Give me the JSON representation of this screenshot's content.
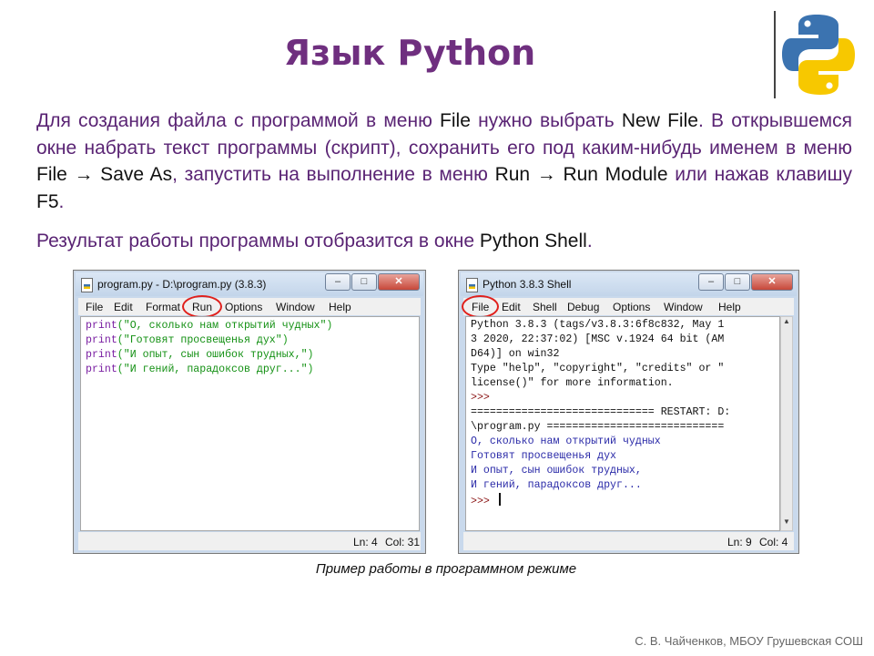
{
  "slide": {
    "title": "Язык Python",
    "para1_a": "Для создания файла с программой в меню ",
    "para1_b": "File",
    "para1_c": " нужно выбрать ",
    "para1_d": "New File",
    "para1_e": ". В открывшемся окне набрать текст программы (скрипт), сохранить его под каким-нибудь именем в меню ",
    "para1_f": "File → Save As",
    "para1_g": ", запустить на выполнение в меню ",
    "para1_h": "Run → Run Module",
    "para1_i": " или нажав клавишу ",
    "para1_j": "F5",
    "para1_k": ".",
    "para2_a": "Результат работы программы отобразится в окне ",
    "para2_b": "Python Shell",
    "para2_c": ".",
    "caption": "Пример работы в программном режиме",
    "footer": "С. В. Чайченков, МБОУ Грушевская СОШ",
    "logo_icon": "python-logo-icon",
    "accent_color": "#6f2f7f"
  },
  "editor": {
    "title": "program.py - D:\\program.py (3.8.3)",
    "menu": [
      "File",
      "Edit",
      "Format",
      "Run",
      "Options",
      "Window",
      "Help"
    ],
    "code": [
      {
        "kw": "print",
        "open": "(",
        "str": "\"О, сколько нам открытий чудных\"",
        "close": ")"
      },
      {
        "kw": "print",
        "open": "(",
        "str": "\"Готовят просвещенья дух\"",
        "close": ")"
      },
      {
        "kw": "print",
        "open": "(",
        "str": "\"И опыт, сын ошибок трудных,\"",
        "close": ")"
      },
      {
        "kw": "print",
        "open": "(",
        "str": "\"И гений, парадоксов друг...\"",
        "close": ")"
      }
    ],
    "status_ln": "Ln: 4",
    "status_col": "Col: 31"
  },
  "shell": {
    "title": "Python 3.8.3 Shell",
    "menu": [
      "File",
      "Edit",
      "Shell",
      "Debug",
      "Options",
      "Window",
      "Help"
    ],
    "lines": [
      "Python 3.8.3 (tags/v3.8.3:6f8c832, May 1",
      "3 2020, 22:37:02) [MSC v.1924 64 bit (AM",
      "D64)] on win32",
      "Type \"help\", \"copyright\", \"credits\" or \"",
      "license()\" for more information."
    ],
    "prompt1": ">>> ",
    "restart1": "============================= RESTART: D:",
    "restart2": "\\program.py ============================",
    "output": [
      "О, сколько нам открытий чудных",
      "Готовят просвещенья дух",
      "И опыт, сын ошибок трудных,",
      "И гений, парадоксов друг..."
    ],
    "prompt2": ">>> ",
    "status_ln": "Ln: 9",
    "status_col": "Col: 4"
  },
  "window_controls": {
    "minimize": "–",
    "maximize": "□",
    "close": "✕"
  }
}
